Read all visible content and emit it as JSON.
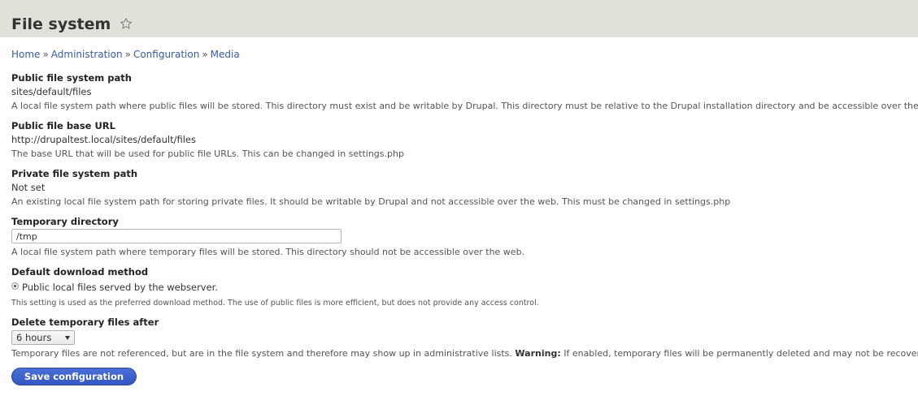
{
  "header": {
    "title": "File system",
    "star_icon": "star-outline-icon"
  },
  "breadcrumb": {
    "items": [
      "Home",
      "Administration",
      "Configuration",
      "Media"
    ],
    "separator": "»"
  },
  "fields": {
    "public_path": {
      "label": "Public file system path",
      "value": "sites/default/files",
      "description": "A local file system path where public files will be stored. This directory must exist and be writable by Drupal. This directory must be relative to the Drupal installation directory and be accessible over the web. This must be changed in settings.php"
    },
    "public_base_url": {
      "label": "Public file base URL",
      "value": "http://drupaltest.local/sites/default/files",
      "description": "The base URL that will be used for public file URLs. This can be changed in settings.php"
    },
    "private_path": {
      "label": "Private file system path",
      "value": "Not set",
      "description": "An existing local file system path for storing private files. It should be writable by Drupal and not accessible over the web. This must be changed in settings.php"
    },
    "temporary_directory": {
      "label": "Temporary directory",
      "value": "/tmp",
      "description": "A local file system path where temporary files will be stored. This directory should not be accessible over the web."
    },
    "download_method": {
      "label": "Default download method",
      "option": "Public local files served by the webserver.",
      "selected": true,
      "description": "This setting is used as the preferred download method. The use of public files is more efficient, but does not provide any access control."
    },
    "delete_temp": {
      "label": "Delete temporary files after",
      "selected": "6 hours",
      "description_prefix": "Temporary files are not referenced, but are in the file system and therefore may show up in administrative lists.",
      "warning_label": "Warning:",
      "description_suffix": "If enabled, temporary files will be permanently deleted and may not be recoverable."
    }
  },
  "actions": {
    "save_label": "Save configuration"
  },
  "colors": {
    "header_bg": "#e0e2da",
    "link": "#3a5ba0",
    "button": "#3d5fc8"
  }
}
